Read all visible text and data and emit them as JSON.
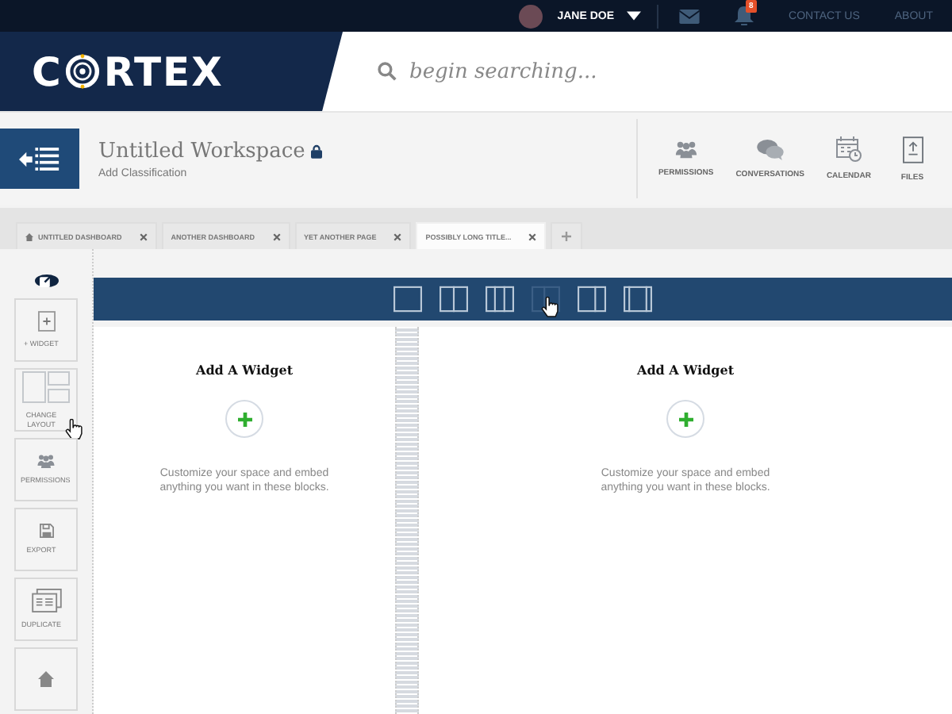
{
  "topbar": {
    "user_name": "JANE DOE",
    "notification_count": "8",
    "links": [
      "CONTACT US",
      "ABOUT"
    ]
  },
  "logo": {
    "before": "C",
    "after": "RTEX"
  },
  "search": {
    "placeholder": "begin searching..."
  },
  "workspace": {
    "title": "Untitled Workspace",
    "locked": true,
    "subtitle": "Add Classification",
    "actions": [
      {
        "kind": "permissions",
        "label": "PERMISSIONS"
      },
      {
        "kind": "conversations",
        "label": "CONVERSATIONS"
      },
      {
        "kind": "calendar",
        "label": "CALENDAR"
      },
      {
        "kind": "files",
        "label": "FILES"
      }
    ]
  },
  "tabs": [
    {
      "label": "UNTITLED DASHBOARD",
      "home": true,
      "selected": false
    },
    {
      "label": "ANOTHER DASHBOARD",
      "home": false,
      "selected": false
    },
    {
      "label": "YET ANOTHER PAGE",
      "home": false,
      "selected": false
    },
    {
      "label": "POSSIBLY LONG TITLE...",
      "home": false,
      "selected": true
    }
  ],
  "layout_options": [
    {
      "kind": "single",
      "selected": false
    },
    {
      "kind": "two",
      "selected": false
    },
    {
      "kind": "three",
      "selected": false
    },
    {
      "kind": "narrow-left",
      "selected": true
    },
    {
      "kind": "wide-left",
      "selected": false
    },
    {
      "kind": "sidebars",
      "selected": false
    }
  ],
  "tools": [
    {
      "kind": "widget",
      "label": "+ WIDGET"
    },
    {
      "kind": "layout",
      "label": "CHANGE LAYOUT"
    },
    {
      "kind": "permissions",
      "label": "PERMISSIONS"
    },
    {
      "kind": "export",
      "label": "EXPORT"
    },
    {
      "kind": "duplicate",
      "label": "DUPLICATE"
    },
    {
      "kind": "home"
    }
  ],
  "widgets": [
    {
      "title": "Add A Widget",
      "description": "Customize your space and embed anything you want in these blocks."
    },
    {
      "title": "Add A Widget",
      "description": "Customize your space and embed anything you want in these blocks."
    }
  ]
}
